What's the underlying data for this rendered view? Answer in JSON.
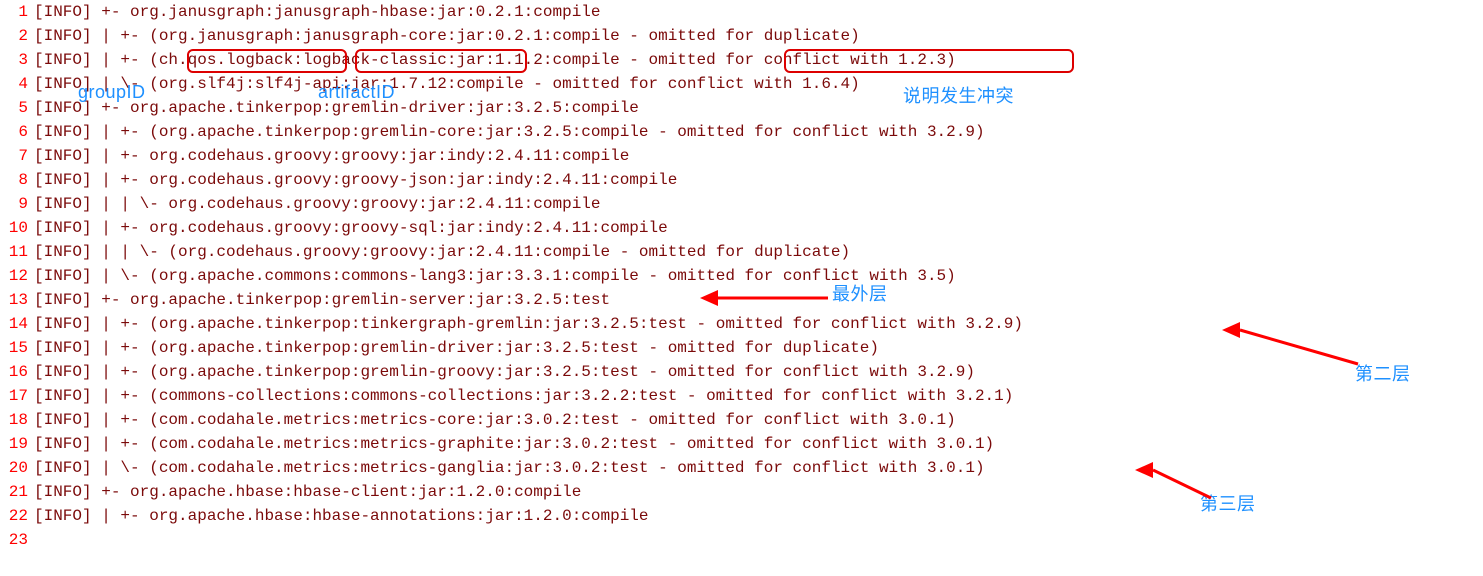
{
  "lines": [
    {
      "num": 1,
      "level": "[INFO]",
      "tree": "+- ",
      "dep": "org.janusgraph:janusgraph-hbase:jar:0.2.1:compile"
    },
    {
      "num": 2,
      "level": "[INFO]",
      "tree": "|  +- ",
      "dep": "(org.janusgraph:janusgraph-core:jar:0.2.1:compile - omitted for duplicate)"
    },
    {
      "num": 3,
      "level": "[INFO]",
      "tree": "|  +- ",
      "dep": "(ch.qos.logback:logback-classic:jar:1.1.2:compile - omitted for conflict with 1.2.3)"
    },
    {
      "num": 4,
      "level": "[INFO]",
      "tree": "|  \\- ",
      "dep": "(org.slf4j:slf4j-api:jar:1.7.12:compile - omitted for conflict with 1.6.4)"
    },
    {
      "num": 5,
      "level": "[INFO]",
      "tree": "+- ",
      "dep": "org.apache.tinkerpop:gremlin-driver:jar:3.2.5:compile"
    },
    {
      "num": 6,
      "level": "[INFO]",
      "tree": "|  +- ",
      "dep": "(org.apache.tinkerpop:gremlin-core:jar:3.2.5:compile - omitted for conflict with 3.2.9)"
    },
    {
      "num": 7,
      "level": "[INFO]",
      "tree": "|  +- ",
      "dep": "org.codehaus.groovy:groovy:jar:indy:2.4.11:compile"
    },
    {
      "num": 8,
      "level": "[INFO]",
      "tree": "|  +- ",
      "dep": "org.codehaus.groovy:groovy-json:jar:indy:2.4.11:compile"
    },
    {
      "num": 9,
      "level": "[INFO]",
      "tree": "|  |  \\- ",
      "dep": "org.codehaus.groovy:groovy:jar:2.4.11:compile"
    },
    {
      "num": 10,
      "level": "[INFO]",
      "tree": "|  +- ",
      "dep": "org.codehaus.groovy:groovy-sql:jar:indy:2.4.11:compile"
    },
    {
      "num": 11,
      "level": "[INFO]",
      "tree": "|  |  \\- ",
      "dep": "(org.codehaus.groovy:groovy:jar:2.4.11:compile - omitted for duplicate)"
    },
    {
      "num": 12,
      "level": "[INFO]",
      "tree": "|  \\- ",
      "dep": "(org.apache.commons:commons-lang3:jar:3.3.1:compile - omitted for conflict with 3.5)"
    },
    {
      "num": 13,
      "level": "[INFO]",
      "tree": "+- ",
      "dep": "org.apache.tinkerpop:gremlin-server:jar:3.2.5:test"
    },
    {
      "num": 14,
      "level": "[INFO]",
      "tree": "|  +- ",
      "dep": "(org.apache.tinkerpop:tinkergraph-gremlin:jar:3.2.5:test - omitted for conflict with 3.2.9)"
    },
    {
      "num": 15,
      "level": "[INFO]",
      "tree": "|  +- ",
      "dep": "(org.apache.tinkerpop:gremlin-driver:jar:3.2.5:test - omitted for duplicate)"
    },
    {
      "num": 16,
      "level": "[INFO]",
      "tree": "|  +- ",
      "dep": "(org.apache.tinkerpop:gremlin-groovy:jar:3.2.5:test - omitted for conflict with 3.2.9)"
    },
    {
      "num": 17,
      "level": "[INFO]",
      "tree": "|  +- ",
      "dep": "(commons-collections:commons-collections:jar:3.2.2:test - omitted for conflict with 3.2.1)"
    },
    {
      "num": 18,
      "level": "[INFO]",
      "tree": "|  +- ",
      "dep": "(com.codahale.metrics:metrics-core:jar:3.0.2:test - omitted for conflict with 3.0.1)"
    },
    {
      "num": 19,
      "level": "[INFO]",
      "tree": "|  +- ",
      "dep": "(com.codahale.metrics:metrics-graphite:jar:3.0.2:test - omitted for conflict with 3.0.1)"
    },
    {
      "num": 20,
      "level": "[INFO]",
      "tree": "|  \\- ",
      "dep": "(com.codahale.metrics:metrics-ganglia:jar:3.0.2:test - omitted for conflict with 3.0.1)"
    },
    {
      "num": 21,
      "level": "[INFO]",
      "tree": "+- ",
      "dep": "org.apache.hbase:hbase-client:jar:1.2.0:compile"
    },
    {
      "num": 22,
      "level": "[INFO]",
      "tree": "|  +- ",
      "dep": "org.apache.hbase:hbase-annotations:jar:1.2.0:compile"
    },
    {
      "num": 23,
      "level": "",
      "tree": "",
      "dep": ""
    }
  ],
  "annotations": {
    "groupID": "groupID",
    "artifactID": "artifactID",
    "conflict": "说明发生冲突",
    "outermost": "最外层",
    "secondLayer": "第二层",
    "thirdLayer": "第三层"
  }
}
